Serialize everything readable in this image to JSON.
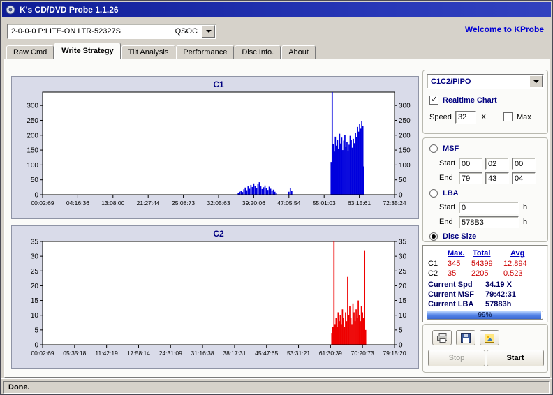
{
  "window": {
    "title": "K's CD/DVD Probe 1.1.26"
  },
  "toolbar": {
    "drive_value": "2-0-0-0 P:LITE-ON LTR-52327S",
    "drive_tag": "QSOC",
    "link_label": "Welcome to KProbe"
  },
  "tabs": [
    {
      "label": "Raw Cmd",
      "active": false
    },
    {
      "label": "Write Strategy",
      "active": true
    },
    {
      "label": "Tilt Analysis",
      "active": false
    },
    {
      "label": "Performance",
      "active": false
    },
    {
      "label": "Disc Info.",
      "active": false
    },
    {
      "label": "About",
      "active": false
    }
  ],
  "panel": {
    "mode_combo_value": "C1C2/PIPO",
    "realtime_label": "Realtime Chart",
    "realtime_checked": true,
    "speed_label": "Speed",
    "speed_value": "32",
    "speed_unit": "X",
    "max_label": "Max",
    "max_checked": false,
    "msf": {
      "label": "MSF",
      "selected": false,
      "start_label": "Start",
      "end_label": "End",
      "start": [
        "00",
        "02",
        "00"
      ],
      "end": [
        "79",
        "43",
        "04"
      ]
    },
    "lba": {
      "label": "LBA",
      "selected": false,
      "start_label": "Start",
      "end_label": "End",
      "start": "0",
      "end": "578B3",
      "unit": "h"
    },
    "disc_size": {
      "label": "Disc Size",
      "selected": true
    },
    "stats": {
      "col_headers": [
        "Max.",
        "Total",
        "Avg"
      ],
      "rows": [
        {
          "label": "C1",
          "max": "345",
          "total": "54399",
          "avg": "12.894"
        },
        {
          "label": "C2",
          "max": "35",
          "total": "2205",
          "avg": "0.523"
        }
      ],
      "current": [
        {
          "label": "Current Spd",
          "value": "34.19 X"
        },
        {
          "label": "Current MSF",
          "value": "79:42:31"
        },
        {
          "label": "Current LBA",
          "value": "57883h"
        }
      ],
      "progress_percent": 99,
      "progress_label": "99%"
    },
    "action_icons": [
      "print-icon",
      "save-icon",
      "export-image-icon"
    ],
    "buttons": {
      "stop": "Stop",
      "start": "Start"
    }
  },
  "statusbar": {
    "text": "Done."
  },
  "chart_data": [
    {
      "type": "bar",
      "title": "C1",
      "color": "#0000dd",
      "ylim": [
        0,
        345
      ],
      "yticks": [
        0,
        50,
        100,
        150,
        200,
        250,
        300
      ],
      "xticklabels": [
        "00:02:69",
        "04:16:36",
        "13:08:00",
        "21:27:44",
        "25:08:73",
        "32:05:63",
        "39:20:06",
        "47:05:54",
        "55:01:03",
        "63:15:61",
        "72:35:24"
      ],
      "points": [
        [
          0.556,
          6
        ],
        [
          0.56,
          10
        ],
        [
          0.564,
          14
        ],
        [
          0.568,
          9
        ],
        [
          0.572,
          18
        ],
        [
          0.576,
          24
        ],
        [
          0.58,
          15
        ],
        [
          0.584,
          28
        ],
        [
          0.588,
          20
        ],
        [
          0.592,
          33
        ],
        [
          0.596,
          26
        ],
        [
          0.6,
          38
        ],
        [
          0.604,
          30
        ],
        [
          0.608,
          22
        ],
        [
          0.612,
          35
        ],
        [
          0.616,
          42
        ],
        [
          0.62,
          28
        ],
        [
          0.624,
          19
        ],
        [
          0.628,
          25
        ],
        [
          0.632,
          31
        ],
        [
          0.636,
          23
        ],
        [
          0.64,
          16
        ],
        [
          0.644,
          27
        ],
        [
          0.648,
          20
        ],
        [
          0.652,
          12
        ],
        [
          0.656,
          17
        ],
        [
          0.66,
          10
        ],
        [
          0.664,
          7
        ],
        [
          0.7,
          10
        ],
        [
          0.704,
          22
        ],
        [
          0.708,
          14
        ],
        [
          0.82,
          110
        ],
        [
          0.823,
          345
        ],
        [
          0.826,
          170
        ],
        [
          0.829,
          145
        ],
        [
          0.832,
          195
        ],
        [
          0.835,
          165
        ],
        [
          0.838,
          185
        ],
        [
          0.841,
          155
        ],
        [
          0.844,
          205
        ],
        [
          0.847,
          172
        ],
        [
          0.85,
          192
        ],
        [
          0.853,
          150
        ],
        [
          0.856,
          182
        ],
        [
          0.859,
          200
        ],
        [
          0.862,
          162
        ],
        [
          0.865,
          178
        ],
        [
          0.868,
          148
        ],
        [
          0.871,
          168
        ],
        [
          0.874,
          198
        ],
        [
          0.877,
          183
        ],
        [
          0.88,
          158
        ],
        [
          0.883,
          188
        ],
        [
          0.886,
          173
        ],
        [
          0.889,
          208
        ],
        [
          0.892,
          193
        ],
        [
          0.895,
          228
        ],
        [
          0.898,
          212
        ],
        [
          0.901,
          238
        ],
        [
          0.904,
          222
        ],
        [
          0.907,
          248
        ],
        [
          0.91,
          232
        ],
        [
          0.913,
          95
        ]
      ]
    },
    {
      "type": "bar",
      "title": "C2",
      "color": "#ee0000",
      "ylim": [
        0,
        35
      ],
      "yticks": [
        0,
        5,
        10,
        15,
        20,
        25,
        30,
        35
      ],
      "xticklabels": [
        "00:02:69",
        "05:35:18",
        "11:42:19",
        "17:58:14",
        "24:31:09",
        "31:16:38",
        "38:17:31",
        "45:47:65",
        "53:31:21",
        "61:30:39",
        "70:20:73",
        "79:15:20"
      ],
      "points": [
        [
          0.822,
          4
        ],
        [
          0.825,
          6
        ],
        [
          0.828,
          35
        ],
        [
          0.831,
          7
        ],
        [
          0.834,
          9
        ],
        [
          0.837,
          6
        ],
        [
          0.84,
          11
        ],
        [
          0.843,
          8
        ],
        [
          0.846,
          10
        ],
        [
          0.849,
          7
        ],
        [
          0.852,
          12
        ],
        [
          0.855,
          9
        ],
        [
          0.858,
          6
        ],
        [
          0.861,
          11
        ],
        [
          0.864,
          8
        ],
        [
          0.867,
          23
        ],
        [
          0.87,
          10
        ],
        [
          0.873,
          13
        ],
        [
          0.876,
          9
        ],
        [
          0.879,
          7
        ],
        [
          0.882,
          14
        ],
        [
          0.885,
          11
        ],
        [
          0.888,
          8
        ],
        [
          0.891,
          12
        ],
        [
          0.894,
          9
        ],
        [
          0.897,
          15
        ],
        [
          0.9,
          10
        ],
        [
          0.903,
          8
        ],
        [
          0.906,
          13
        ],
        [
          0.909,
          11
        ],
        [
          0.912,
          9
        ],
        [
          0.915,
          32
        ],
        [
          0.918,
          5
        ]
      ]
    }
  ]
}
